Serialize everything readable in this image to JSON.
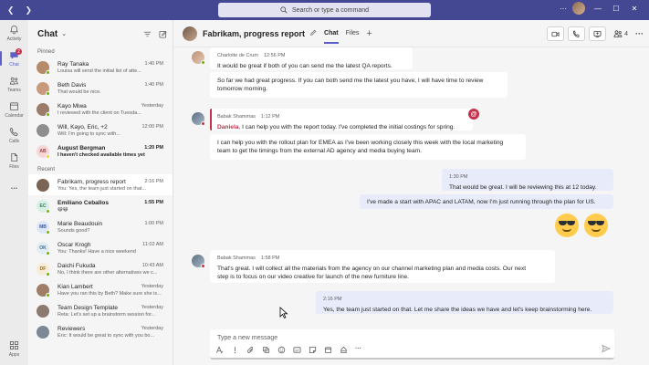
{
  "search": {
    "placeholder": "Search or type a command"
  },
  "rail": [
    {
      "label": "Activity",
      "icon": "bell-icon"
    },
    {
      "label": "Chat",
      "icon": "chat-icon",
      "badge": "2",
      "active": true
    },
    {
      "label": "Teams",
      "icon": "teams-icon"
    },
    {
      "label": "Calendar",
      "icon": "calendar-icon"
    },
    {
      "label": "Calls",
      "icon": "phone-icon"
    },
    {
      "label": "Files",
      "icon": "file-icon"
    },
    {
      "label": "...",
      "icon": "more-icon"
    }
  ],
  "rail_bottom": {
    "label": "Apps",
    "icon": "apps-icon"
  },
  "chatlist": {
    "title": "Chat",
    "pinned_label": "Pinned",
    "recent_label": "Recent",
    "pinned": [
      {
        "name": "Ray Tanaka",
        "time": "1:40 PM",
        "preview": "Louisa will send the initial list of atte...",
        "status": "online",
        "color": "#b58b6a"
      },
      {
        "name": "Beth Davis",
        "time": "1:40 PM",
        "preview": "That would be nice.",
        "status": "online",
        "color": "#c79a7c"
      },
      {
        "name": "Kayo Miwa",
        "time": "Yesterday",
        "preview": "I reviewed with the client on Tuesda...",
        "status": "online",
        "color": "#9b7b6a"
      },
      {
        "name": "Will, Kayo, Eric, +2",
        "time": "12:00 PM",
        "preview": "Will: I'm going to sync with...",
        "status": "none",
        "color": "#8e8e8e"
      },
      {
        "name": "August Bergman",
        "time": "1:20 PM",
        "preview": "I haven't checked available times yet",
        "status": "away",
        "initials": "AB",
        "color": "#f6d7d7",
        "textcolor": "#a33a3a",
        "unread": true
      }
    ],
    "recent": [
      {
        "name": "Fabrikam, progress report",
        "time": "2:16 PM",
        "preview": "You: Yes, the team just started on that...",
        "status": "none",
        "color": "#7a6454",
        "selected": true
      },
      {
        "name": "Emiliano Ceballos",
        "time": "1:55 PM",
        "preview": "😄😄",
        "status": "online",
        "initials": "EC",
        "color": "#d9efe4",
        "textcolor": "#2e7d5a",
        "unread": true
      },
      {
        "name": "Marie Beaudouin",
        "time": "1:00 PM",
        "preview": "Sounds good?",
        "status": "online",
        "initials": "MB",
        "color": "#dfe6f7",
        "textcolor": "#3a5aa3"
      },
      {
        "name": "Oscar Krogh",
        "time": "11:02 AM",
        "preview": "You: Thanks! Have a nice weekend",
        "status": "online",
        "initials": "OK",
        "color": "#e1ecf4",
        "textcolor": "#3a6f8e"
      },
      {
        "name": "Daichi Fukuda",
        "time": "10:43 AM",
        "preview": "No, I think there are other alternatives we c...",
        "status": "online",
        "initials": "DF",
        "color": "#f7ecd7",
        "textcolor": "#8e6a2a"
      },
      {
        "name": "Kian Lambert",
        "time": "Yesterday",
        "preview": "Have you ran this by Beth? Make sure she is...",
        "status": "online",
        "color": "#a07d66"
      },
      {
        "name": "Team Design Template",
        "time": "Yesterday",
        "preview": "Reta: Let's set up a brainstorm session for...",
        "status": "none",
        "color": "#8c7a70"
      },
      {
        "name": "Reviewers",
        "time": "Yesterday",
        "preview": "Eric: It would be great to sync with you bo...",
        "status": "none",
        "color": "#7d8896"
      }
    ]
  },
  "conversation": {
    "title": "Fabrikam, progress report",
    "tabs": [
      "Chat",
      "Files"
    ],
    "participants_count": "4",
    "messages": [
      {
        "id": "m1",
        "sender": "Charlotte de Crum",
        "time": "12:56 PM",
        "lines": [
          "It would be great if both of you can send me the latest QA reports."
        ]
      },
      {
        "id": "m2",
        "lines": [
          "So far we had great progress. If you can both send me the latest you have, I will have time to review",
          "tomorrow morning."
        ]
      },
      {
        "id": "m3",
        "sender": "Babak Shammas",
        "time": "1:12 PM",
        "mention": "Daniela",
        "text_after": ", I can help you with the report today. I've completed the initial costings for spring."
      },
      {
        "id": "m4",
        "lines": [
          "I can help you with the rollout plan for EMEA as I've been working closely this week with the local marketing",
          "team to get the timings from the external AD agency and media buying team."
        ]
      },
      {
        "id": "m5",
        "time": "1:30 PM",
        "lines": [
          "That would be great. I will be reviewing this at 12 today."
        ]
      },
      {
        "id": "m6",
        "lines": [
          "I've made a start with APAC and LATAM, now I'm just running through the plan for US."
        ]
      },
      {
        "id": "m7",
        "sender": "Babak Shammas",
        "time": "1:58 PM",
        "lines": [
          "That's great. I will collect all the materials from the agency on our channel marketing plan and media costs. Our next",
          "step is to focus on our video creative for launch of the new furniture line."
        ]
      },
      {
        "id": "m8",
        "time": "2:16 PM",
        "lines": [
          "Yes, the team just started on that. Let me share the ideas we have and let's keep brainstorming here."
        ]
      }
    ],
    "mention_badge": "@"
  },
  "composer": {
    "placeholder": "Type a new message"
  }
}
